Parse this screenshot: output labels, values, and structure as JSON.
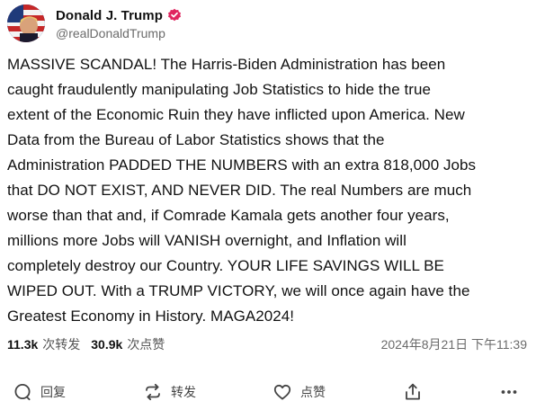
{
  "author": {
    "display_name": "Donald J. Trump",
    "handle": "@realDonaldTrump",
    "verified_icon": "verified-badge-icon"
  },
  "post": {
    "lines": [
      "MASSIVE SCANDAL! The Harris-Biden Administration has been",
      "caught fraudulently manipulating Job Statistics to hide the true",
      "extent of the Economic Ruin they have inflicted upon America. New",
      "Data from the Bureau of Labor Statistics shows that the",
      "Administration PADDED THE NUMBERS with an extra 818,000 Jobs",
      "that DO NOT EXIST, AND NEVER DID. The real Numbers are much",
      "worse than that and, if Comrade Kamala gets another four years,",
      "millions more Jobs will VANISH overnight, and Inflation will",
      "completely destroy our Country. YOUR LIFE SAVINGS WILL BE",
      "WIPED OUT. With a TRUMP VICTORY, we will once again have the",
      "Greatest Economy in History. MAGA2024!"
    ]
  },
  "stats": {
    "retruths_count": "11.3k",
    "retruths_label": "次转发",
    "likes_count": "30.9k",
    "likes_label": "次点赞",
    "timestamp": "2024年8月21日 下午11:39"
  },
  "actions": {
    "reply_label": "回复",
    "retruth_label": "转发",
    "like_label": "点赞"
  },
  "colors": {
    "verified_badge": "#e0245e",
    "text_primary": "#111111",
    "text_secondary": "#6b6b6b"
  }
}
